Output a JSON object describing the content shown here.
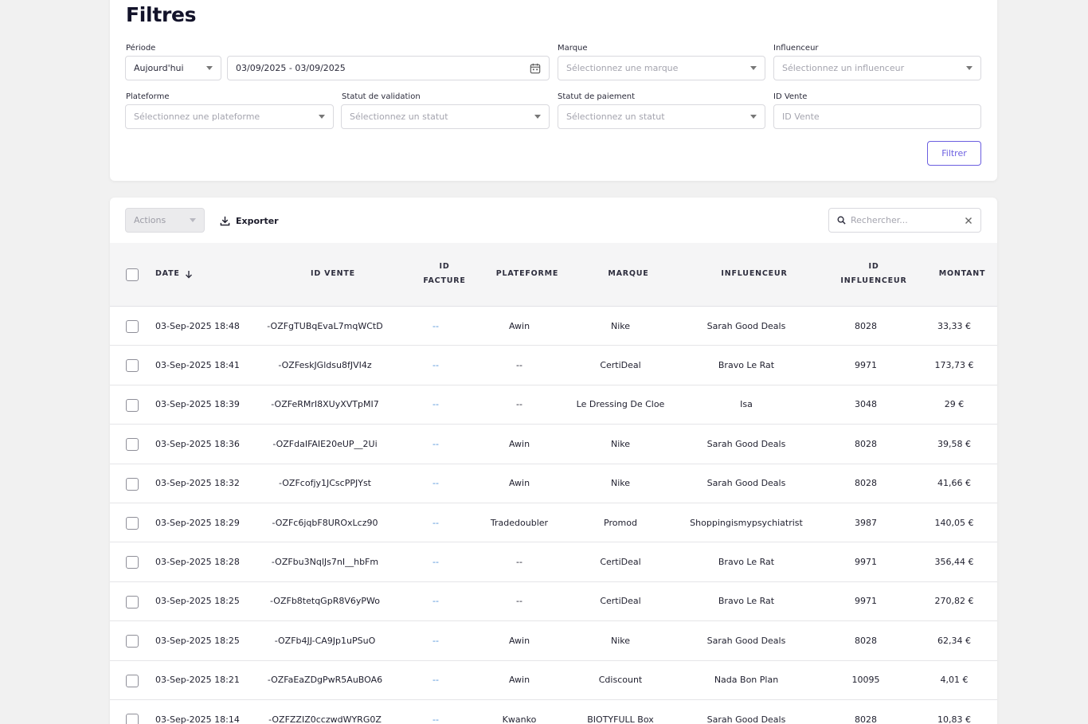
{
  "filters": {
    "title": "Filtres",
    "periode": {
      "label": "Période",
      "value": "Aujourd'hui"
    },
    "date_range": {
      "value": "03/09/2025 - 03/09/2025"
    },
    "marque": {
      "label": "Marque",
      "placeholder": "Sélectionnez une marque"
    },
    "influenceur": {
      "label": "Influenceur",
      "placeholder": "Sélectionnez un influenceur"
    },
    "plateforme": {
      "label": "Plateforme",
      "placeholder": "Sélectionnez une plateforme"
    },
    "statut_validation": {
      "label": "Statut de validation",
      "placeholder": "Sélectionnez un statut"
    },
    "statut_paiement": {
      "label": "Statut de paiement",
      "placeholder": "Sélectionnez un statut"
    },
    "id_vente": {
      "label": "ID Vente",
      "placeholder": "ID Vente"
    },
    "filter_button": "Filtrer"
  },
  "toolbar": {
    "actions_label": "Actions",
    "export_label": "Exporter",
    "search_placeholder": "Rechercher..."
  },
  "table": {
    "columns": {
      "date": "Date",
      "id_vente": "ID Vente",
      "id_facture_1": "ID",
      "id_facture_2": "Facture",
      "plateforme": "Plateforme",
      "marque": "Marque",
      "influenceur": "Influenceur",
      "id_influenceur_1": "ID",
      "id_influenceur_2": "Influenceur",
      "montant": "Montant"
    },
    "rows": [
      {
        "date": "03-Sep-2025 18:48",
        "id_vente": "-OZFgTUBqEvaL7mqWCtD",
        "id_facture": "--",
        "plateforme": "Awin",
        "marque": "Nike",
        "influenceur": "Sarah Good Deals",
        "id_influenceur": "8028",
        "montant": "33,33 €"
      },
      {
        "date": "03-Sep-2025 18:41",
        "id_vente": "-OZFeskJGldsu8fJVI4z",
        "id_facture": "--",
        "plateforme": "--",
        "marque": "CertiDeal",
        "influenceur": "Bravo Le Rat",
        "id_influenceur": "9971",
        "montant": "173,73 €"
      },
      {
        "date": "03-Sep-2025 18:39",
        "id_vente": "-OZFeRMrI8XUyXVTpMI7",
        "id_facture": "--",
        "plateforme": "--",
        "marque": "Le Dressing De Cloe",
        "influenceur": "Isa",
        "id_influenceur": "3048",
        "montant": "29 €"
      },
      {
        "date": "03-Sep-2025 18:36",
        "id_vente": "-OZFdaIFAIE20eUP__2Ui",
        "id_facture": "--",
        "plateforme": "Awin",
        "marque": "Nike",
        "influenceur": "Sarah Good Deals",
        "id_influenceur": "8028",
        "montant": "39,58 €"
      },
      {
        "date": "03-Sep-2025 18:32",
        "id_vente": "-OZFcofjy1JCscPPJYst",
        "id_facture": "--",
        "plateforme": "Awin",
        "marque": "Nike",
        "influenceur": "Sarah Good Deals",
        "id_influenceur": "8028",
        "montant": "41,66 €"
      },
      {
        "date": "03-Sep-2025 18:29",
        "id_vente": "-OZFc6jqbF8UROxLcz90",
        "id_facture": "--",
        "plateforme": "Tradedoubler",
        "marque": "Promod",
        "influenceur": "Shoppingismypsychiatrist",
        "id_influenceur": "3987",
        "montant": "140,05 €"
      },
      {
        "date": "03-Sep-2025 18:28",
        "id_vente": "-OZFbu3NqlJs7nI__hbFm",
        "id_facture": "--",
        "plateforme": "--",
        "marque": "CertiDeal",
        "influenceur": "Bravo Le Rat",
        "id_influenceur": "9971",
        "montant": "356,44 €"
      },
      {
        "date": "03-Sep-2025 18:25",
        "id_vente": "-OZFb8tetqGpR8V6yPWo",
        "id_facture": "--",
        "plateforme": "--",
        "marque": "CertiDeal",
        "influenceur": "Bravo Le Rat",
        "id_influenceur": "9971",
        "montant": "270,82 €"
      },
      {
        "date": "03-Sep-2025 18:25",
        "id_vente": "-OZFb4JJ-CA9Jp1uPSuO",
        "id_facture": "--",
        "plateforme": "Awin",
        "marque": "Nike",
        "influenceur": "Sarah Good Deals",
        "id_influenceur": "8028",
        "montant": "62,34 €"
      },
      {
        "date": "03-Sep-2025 18:21",
        "id_vente": "-OZFaEaZDgPwR5AuBOA6",
        "id_facture": "--",
        "plateforme": "Awin",
        "marque": "Cdiscount",
        "influenceur": "Nada Bon Plan",
        "id_influenceur": "10095",
        "montant": "4,01 €"
      },
      {
        "date": "03-Sep-2025 18:14",
        "id_vente": "-OZFZZIZ0cczwdWYRG0Z",
        "id_facture": "--",
        "plateforme": "Kwanko",
        "marque": "BIOTYFULL Box",
        "influenceur": "Sarah Good Deals",
        "id_influenceur": "8028",
        "montant": "10,83 €"
      }
    ]
  },
  "colors": {
    "accent": "#6b5ee0",
    "link_dash": "#4a8fd8"
  }
}
